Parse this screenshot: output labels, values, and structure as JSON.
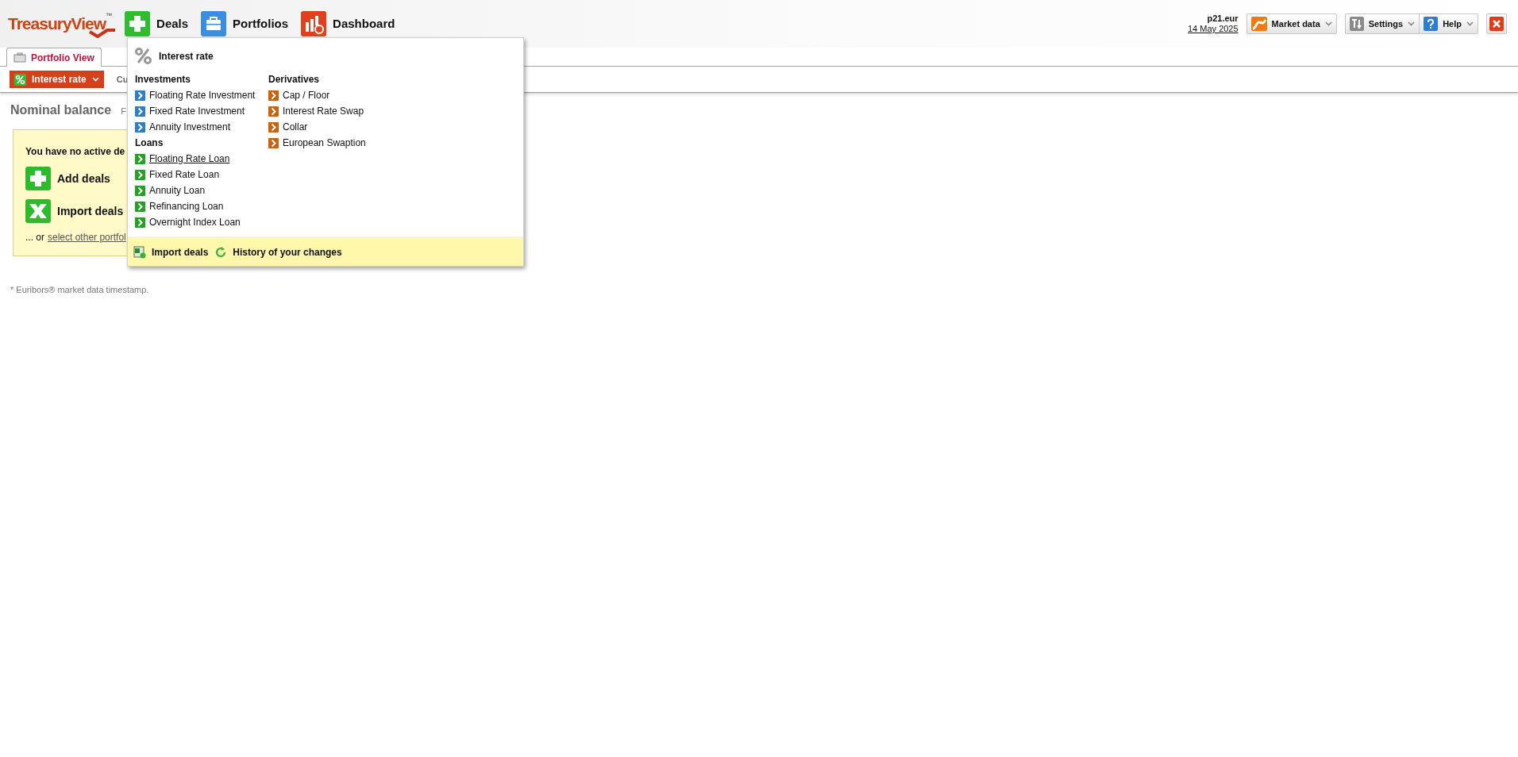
{
  "logo": {
    "text": "TreasuryView",
    "trademark": "™"
  },
  "nav": [
    {
      "label": "Deals",
      "kind": "deals"
    },
    {
      "label": "Portfolios",
      "kind": "portfolios"
    },
    {
      "label": "Dashboard",
      "kind": "dashboard"
    }
  ],
  "account": {
    "name": "p21.eur",
    "date": "14 May 2025"
  },
  "toolbar": [
    {
      "buttons": [
        {
          "label": "Market data",
          "kind": "market"
        }
      ]
    },
    {
      "buttons": [
        {
          "label": "Settings",
          "kind": "settings"
        },
        {
          "label": "Help",
          "kind": "help"
        }
      ]
    }
  ],
  "tabs": [
    {
      "label": "Portfolio View",
      "selected": true
    }
  ],
  "filter": {
    "label": "Interest rate",
    "next_label": "Cu"
  },
  "section": {
    "title": "Nominal balance",
    "subtitle": "F"
  },
  "empty_state": {
    "message": "You have no active de",
    "actions": [
      {
        "label": "Add deals",
        "kind": "add"
      },
      {
        "label": "Import deals",
        "kind": "import"
      }
    ],
    "prefix": "... or",
    "link": "select other portfol"
  },
  "footnote": "* Euribors® market data timestamp.",
  "dropdown": {
    "title": "Interest rate",
    "columns": [
      {
        "groups": [
          {
            "heading": "Investments",
            "items": [
              {
                "label": "Floating Rate Investment",
                "kind": "investment",
                "hovered": false
              },
              {
                "label": "Fixed Rate Investment",
                "kind": "investment",
                "hovered": false
              },
              {
                "label": "Annuity Investment",
                "kind": "investment",
                "hovered": false
              }
            ]
          },
          {
            "heading": "Loans",
            "items": [
              {
                "label": "Floating Rate Loan",
                "kind": "loan",
                "hovered": true
              },
              {
                "label": "Fixed Rate Loan",
                "kind": "loan",
                "hovered": false
              },
              {
                "label": "Annuity Loan",
                "kind": "loan",
                "hovered": false
              },
              {
                "label": "Refinancing Loan",
                "kind": "loan",
                "hovered": false
              },
              {
                "label": "Overnight Index Loan",
                "kind": "loan",
                "hovered": false
              }
            ]
          }
        ]
      },
      {
        "groups": [
          {
            "heading": "Derivatives",
            "items": [
              {
                "label": "Cap / Floor",
                "kind": "derivative",
                "hovered": false
              },
              {
                "label": "Interest Rate Swap",
                "kind": "derivative",
                "hovered": false
              },
              {
                "label": "Collar",
                "kind": "derivative",
                "hovered": false
              },
              {
                "label": "European Swaption",
                "kind": "derivative",
                "hovered": false
              }
            ]
          }
        ]
      }
    ],
    "footer": [
      {
        "label": "Import deals",
        "kind": "import"
      },
      {
        "label": "History of your changes",
        "kind": "history"
      }
    ]
  }
}
